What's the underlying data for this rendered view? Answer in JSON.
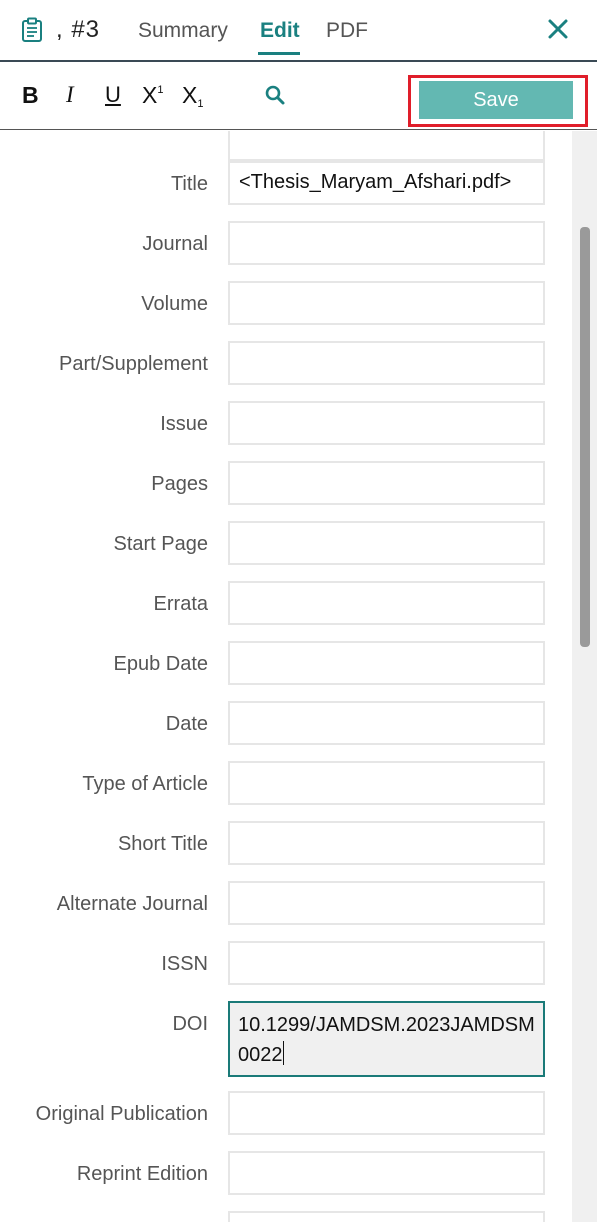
{
  "header": {
    "ref_label": ", #3",
    "tabs": [
      {
        "label": "Summary"
      },
      {
        "label": "Edit"
      },
      {
        "label": "PDF"
      }
    ],
    "active_tab": "Edit",
    "accent_color": "#1a8080"
  },
  "toolbar": {
    "bold": "B",
    "italic": "I",
    "underline": "U",
    "superscript": "X",
    "superscript_mark": "1",
    "subscript": "X",
    "subscript_mark": "1",
    "save_label": "Save",
    "save_color": "#63b8b2",
    "highlight_color": "#e01e2a"
  },
  "form": {
    "fields": [
      {
        "label": "Title",
        "value": "<Thesis_Maryam_Afshari.pdf>"
      },
      {
        "label": "Journal",
        "value": ""
      },
      {
        "label": "Volume",
        "value": ""
      },
      {
        "label": "Part/Supplement",
        "value": ""
      },
      {
        "label": "Issue",
        "value": ""
      },
      {
        "label": "Pages",
        "value": ""
      },
      {
        "label": "Start Page",
        "value": ""
      },
      {
        "label": "Errata",
        "value": ""
      },
      {
        "label": "Epub Date",
        "value": ""
      },
      {
        "label": "Date",
        "value": ""
      },
      {
        "label": "Type of Article",
        "value": ""
      },
      {
        "label": "Short Title",
        "value": ""
      },
      {
        "label": "Alternate Journal",
        "value": ""
      },
      {
        "label": "ISSN",
        "value": ""
      },
      {
        "label": "DOI",
        "value": "10.1299/JAMDSM.2023JAMDSM0022"
      },
      {
        "label": "Original Publication",
        "value": ""
      },
      {
        "label": "Reprint Edition",
        "value": ""
      }
    ]
  },
  "icons": {
    "clipboard": "clipboard-icon",
    "close": "close-icon",
    "search": "search-icon"
  }
}
